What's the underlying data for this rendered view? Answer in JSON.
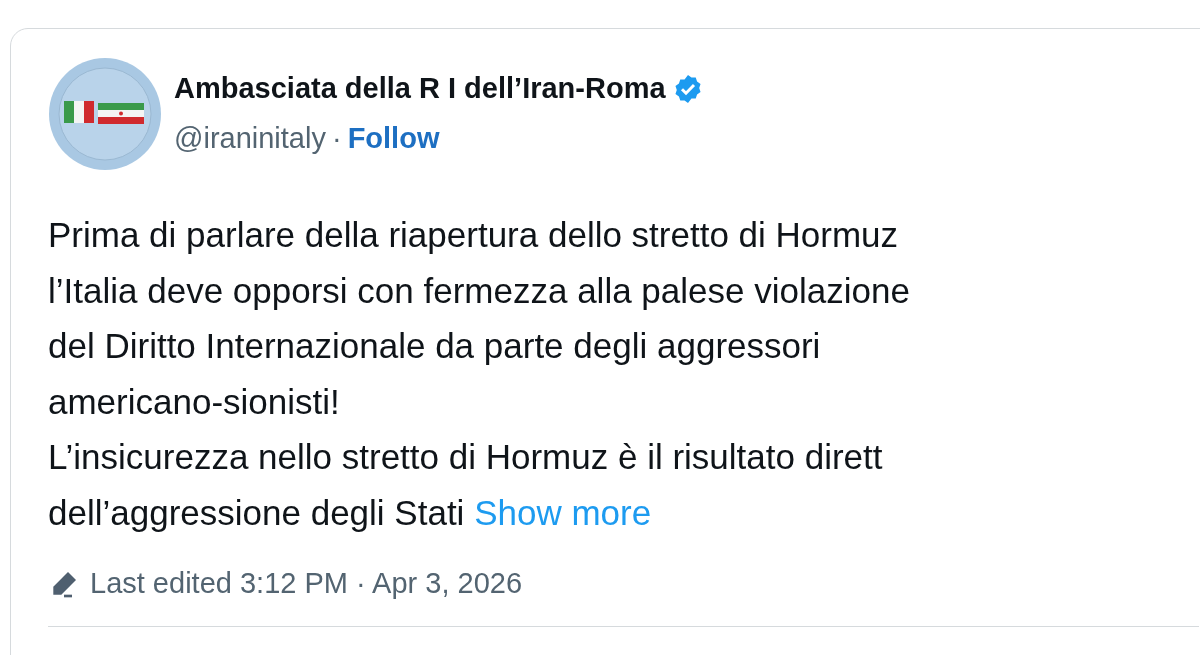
{
  "author": {
    "name": "Ambasciata della R I dell’Iran-Roma",
    "verified": true,
    "handle": "@iraninitaly",
    "separator": "·",
    "follow": "Follow"
  },
  "body": {
    "lines": [
      "Prima di parlare della riapertura dello stretto di Hormuz",
      "l’Italia deve opporsi con fermezza alla palese violazione",
      "del Diritto Internazionale da parte degli aggressori",
      "americano-sionisti!",
      "L’insicurezza nello stretto di Hormuz è il risultato dirett",
      "dell’aggressione degli Stati"
    ],
    "show_more": "Show more"
  },
  "footer": {
    "edited": "Last edited 3:12 PM · Apr 3, 2026"
  }
}
